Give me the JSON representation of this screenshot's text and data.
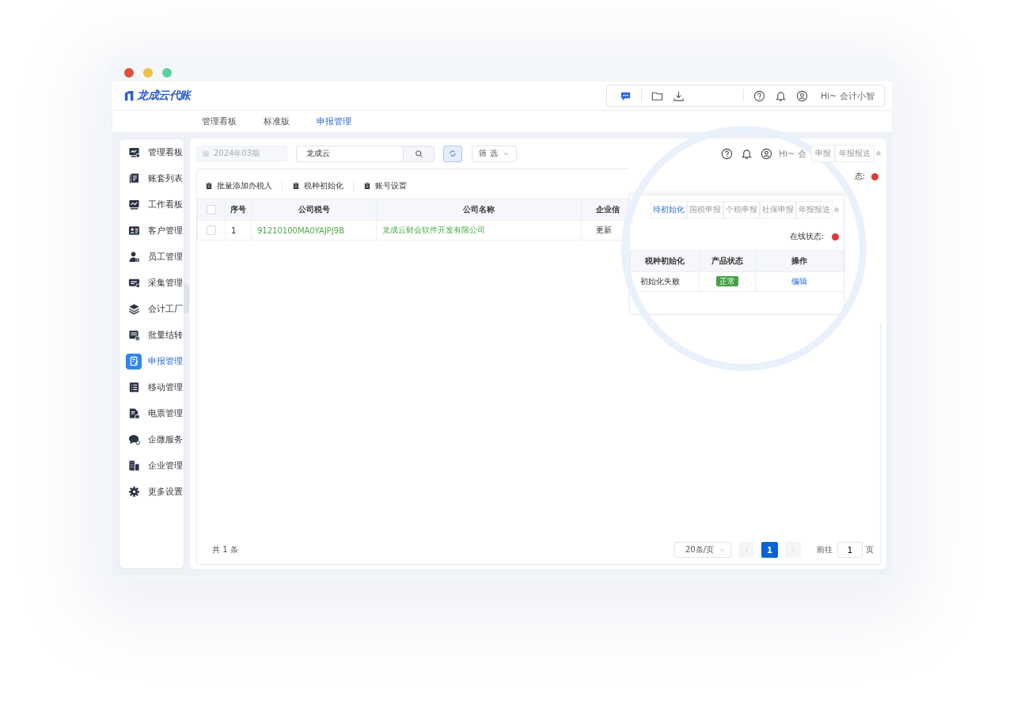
{
  "window": {
    "logo": "龙成云代账"
  },
  "header": {
    "user_greeting": "Hi~ 会计小智"
  },
  "top_tabs": [
    {
      "label": "管理看板",
      "selected": false
    },
    {
      "label": "标准版",
      "selected": false
    },
    {
      "label": "申报管理",
      "selected": true
    }
  ],
  "sidebar": {
    "items": [
      {
        "label": "管理看板",
        "selected": false
      },
      {
        "label": "账套列表",
        "selected": false
      },
      {
        "label": "工作看板",
        "selected": false
      },
      {
        "label": "客户管理",
        "selected": false
      },
      {
        "label": "员工管理",
        "selected": false
      },
      {
        "label": "采集管理",
        "selected": false
      },
      {
        "label": "会计工厂",
        "selected": false
      },
      {
        "label": "批量结转",
        "selected": false
      },
      {
        "label": "申报管理",
        "selected": true
      },
      {
        "label": "移动管理",
        "selected": false
      },
      {
        "label": "电票管理",
        "selected": false
      },
      {
        "label": "企微服务",
        "selected": false
      },
      {
        "label": "企业管理",
        "selected": false
      },
      {
        "label": "更多设置",
        "selected": false
      }
    ]
  },
  "toolbar": {
    "period_placeholder": "2024年03期",
    "period_disabled": true,
    "search_value": "龙成云",
    "filter_label": "筛 选"
  },
  "actions": [
    "批量添加办税人",
    "税种初始化",
    "账号设置"
  ],
  "table": {
    "header_checked": false,
    "columns": [
      "序号",
      "公司税号",
      "公司名称",
      "企业信"
    ],
    "rows": [
      {
        "checked": false,
        "cells": [
          "1",
          "91210100MA0YAJPJ9B",
          "龙成云财会软件开发有限公司",
          "更新"
        ]
      }
    ]
  },
  "pagination": {
    "total": "共 1 条",
    "page_size": "20条/页",
    "pages": [
      {
        "label": "1",
        "selected": true
      }
    ],
    "goto_label": "前往",
    "goto_value": "1",
    "goto_suffix": "页"
  },
  "magnifier": {
    "user_greeting": "Hi~ 会",
    "back_tabs": [
      "申报",
      "年报报送"
    ],
    "back_status_label": "态:",
    "tabs": [
      {
        "label": "待初始化",
        "selected": true
      },
      {
        "label": "国税申报",
        "selected": false
      },
      {
        "label": "个税申报",
        "selected": false
      },
      {
        "label": "社保申报",
        "selected": false
      },
      {
        "label": "年报报送",
        "selected": false
      }
    ],
    "online_label": "在线状态:",
    "table": {
      "columns": [
        "税种初始化",
        "产品状态",
        "操作"
      ],
      "rows": [
        {
          "cells": [
            "初始化失败",
            "正常",
            "编辑"
          ]
        }
      ]
    }
  }
}
